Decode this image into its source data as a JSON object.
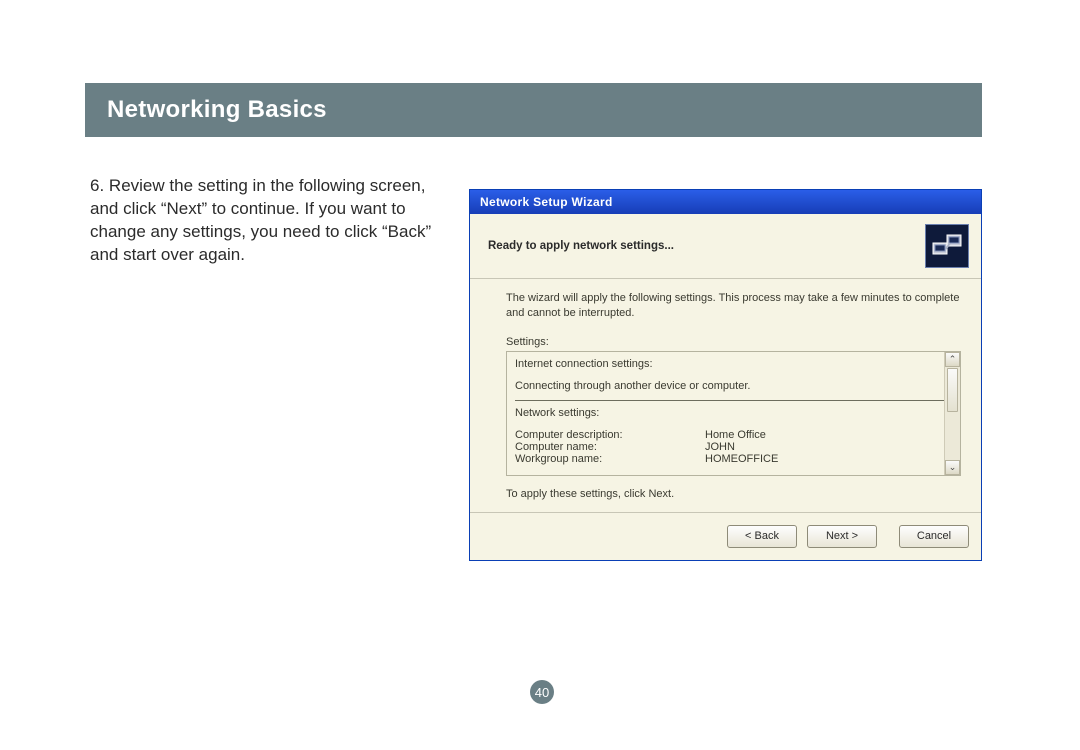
{
  "banner": {
    "title": "Networking Basics"
  },
  "instruction": {
    "number": "6.",
    "text": "Review the setting in the following screen, and click “Next” to continue. If you want to change any settings, you need to click “Back” and start over again."
  },
  "wizard": {
    "title": "Network Setup Wizard",
    "subtitle": "Ready to apply network settings...",
    "intro": "The wizard will apply the following settings. This process may take a few minutes to complete and cannot be interrupted.",
    "settings_label": "Settings:",
    "settings_box": {
      "section1_title": "Internet connection settings:",
      "section1_line": "Connecting through another device or computer.",
      "section2_title": "Network settings:",
      "rows": [
        {
          "k": "Computer description:",
          "v": "Home Office"
        },
        {
          "k": "Computer name:",
          "v": "JOHN"
        },
        {
          "k": "Workgroup name:",
          "v": "HOMEOFFICE"
        }
      ]
    },
    "apply_note": "To apply these settings, click Next.",
    "buttons": {
      "back": "< Back",
      "next": "Next >",
      "cancel": "Cancel"
    },
    "scroll": {
      "up": "⌃",
      "dn": "⌄"
    }
  },
  "page_number": "40"
}
